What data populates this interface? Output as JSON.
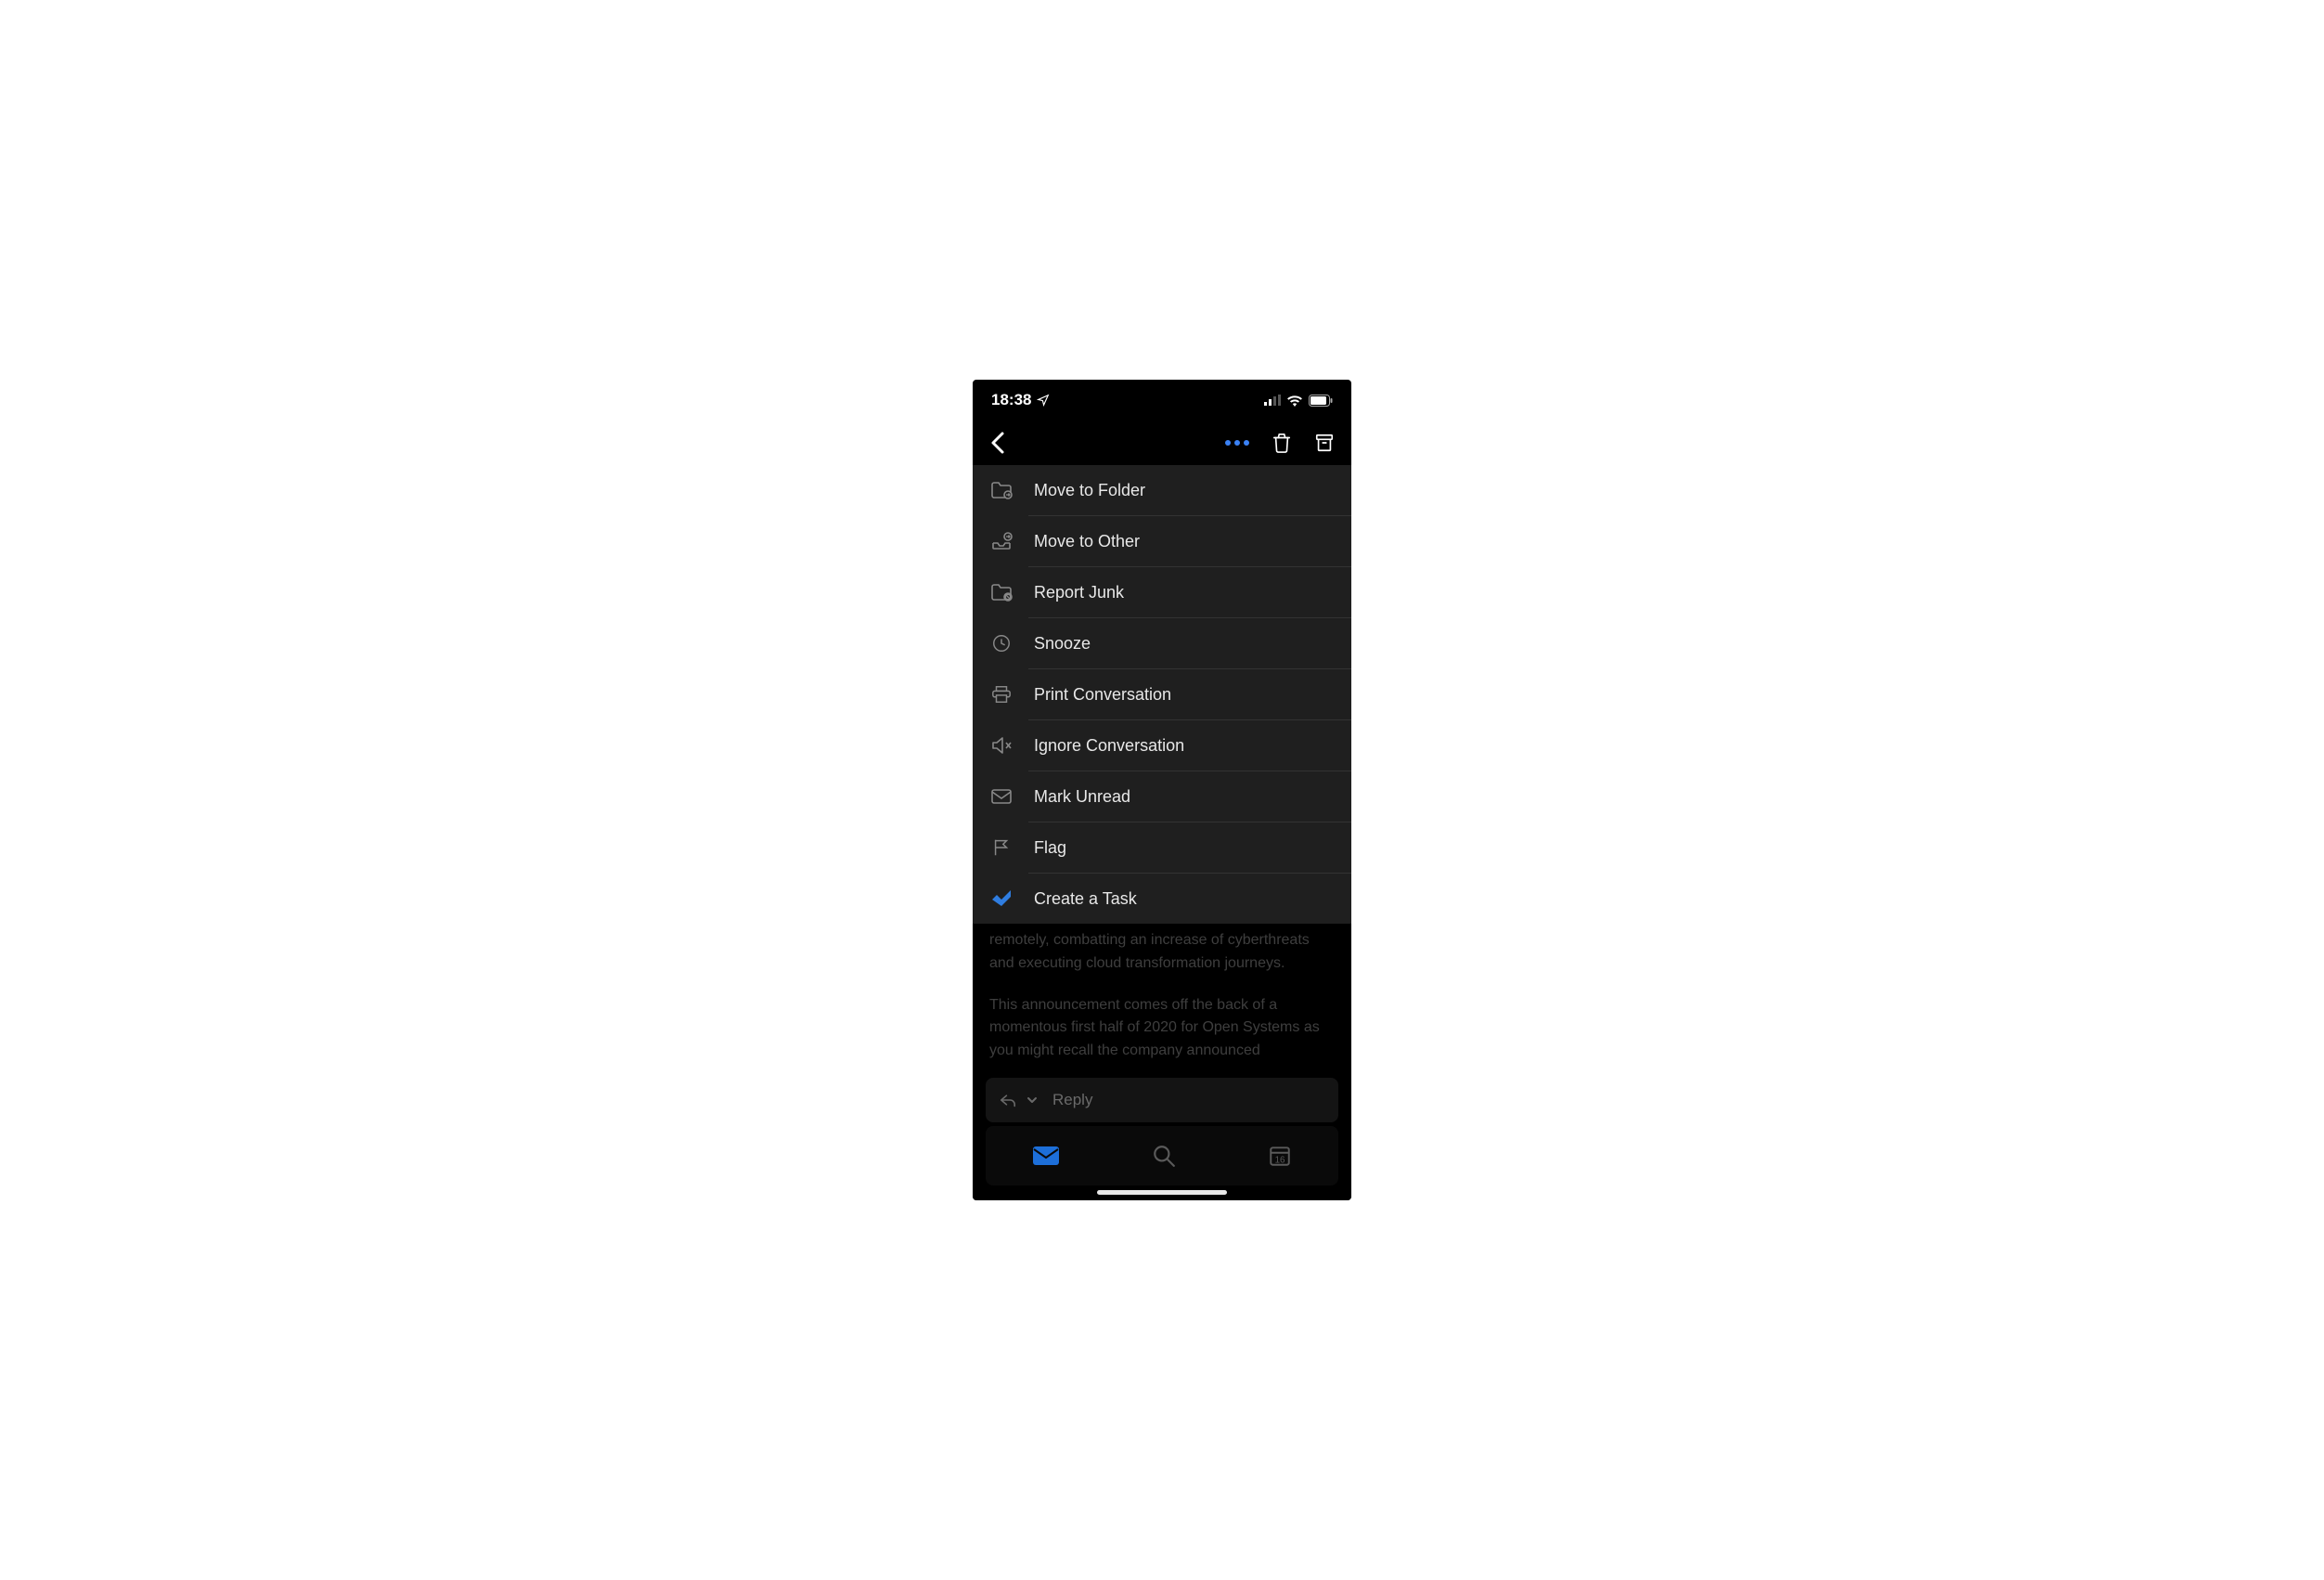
{
  "statusBar": {
    "time": "18:38"
  },
  "menu": {
    "items": [
      {
        "label": "Move to Folder"
      },
      {
        "label": "Move to Other"
      },
      {
        "label": "Report Junk"
      },
      {
        "label": "Snooze"
      },
      {
        "label": "Print Conversation"
      },
      {
        "label": "Ignore Conversation"
      },
      {
        "label": "Mark Unread"
      },
      {
        "label": "Flag"
      },
      {
        "label": "Create a Task"
      }
    ]
  },
  "email": {
    "body1": "remotely, combatting an increase of cyberthreats and executing cloud transformation journeys.",
    "body2": "This announcement comes off the back of a momentous first half of 2020 for Open Systems as you might recall the company announced"
  },
  "replyBar": {
    "label": "Reply"
  },
  "bottomNav": {
    "calendarDay": "16"
  }
}
